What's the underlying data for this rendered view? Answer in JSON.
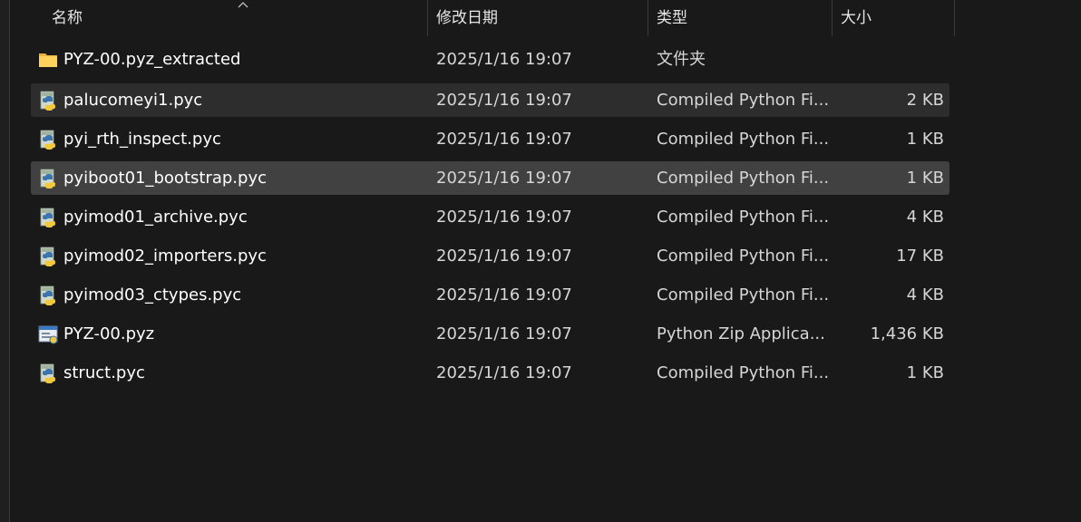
{
  "header": {
    "col_name": "名称",
    "col_date": "修改日期",
    "col_type": "类型",
    "col_size": "大小"
  },
  "files": [
    {
      "icon": "folder-icon",
      "name": "PYZ-00.pyz_extracted",
      "date": "2025/1/16 19:07",
      "type": "文件夹",
      "size": "",
      "state": "normal"
    },
    {
      "icon": "python-file-icon",
      "name": "palucomeyi1.pyc",
      "date": "2025/1/16 19:07",
      "type": "Compiled Python Fi...",
      "size": "2 KB",
      "state": "hover"
    },
    {
      "icon": "python-file-icon",
      "name": "pyi_rth_inspect.pyc",
      "date": "2025/1/16 19:07",
      "type": "Compiled Python Fi...",
      "size": "1 KB",
      "state": "normal"
    },
    {
      "icon": "python-file-icon",
      "name": "pyiboot01_bootstrap.pyc",
      "date": "2025/1/16 19:07",
      "type": "Compiled Python Fi...",
      "size": "1 KB",
      "state": "selected"
    },
    {
      "icon": "python-file-icon",
      "name": "pyimod01_archive.pyc",
      "date": "2025/1/16 19:07",
      "type": "Compiled Python Fi...",
      "size": "4 KB",
      "state": "normal"
    },
    {
      "icon": "python-file-icon",
      "name": "pyimod02_importers.pyc",
      "date": "2025/1/16 19:07",
      "type": "Compiled Python Fi...",
      "size": "17 KB",
      "state": "normal"
    },
    {
      "icon": "python-file-icon",
      "name": "pyimod03_ctypes.pyc",
      "date": "2025/1/16 19:07",
      "type": "Compiled Python Fi...",
      "size": "4 KB",
      "state": "normal"
    },
    {
      "icon": "python-zip-app-icon",
      "name": "PYZ-00.pyz",
      "date": "2025/1/16 19:07",
      "type": "Python Zip Applica...",
      "size": "1,436 KB",
      "state": "normal"
    },
    {
      "icon": "python-file-icon",
      "name": "struct.pyc",
      "date": "2025/1/16 19:07",
      "type": "Compiled Python Fi...",
      "size": "1 KB",
      "state": "normal"
    }
  ]
}
